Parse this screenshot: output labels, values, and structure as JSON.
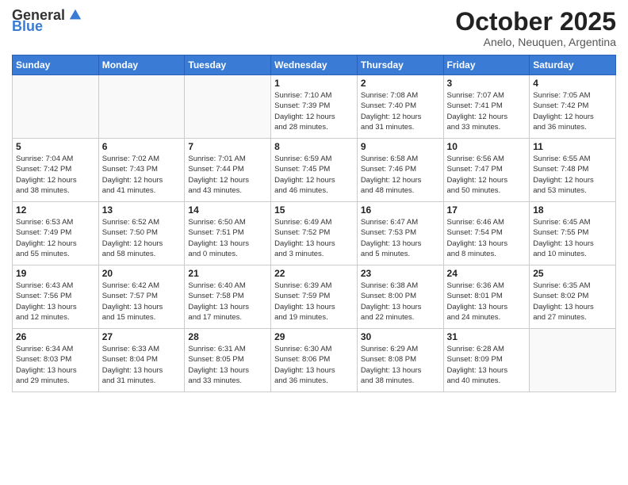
{
  "logo": {
    "general": "General",
    "blue": "Blue"
  },
  "calendar": {
    "title": "October 2025",
    "subtitle": "Anelo, Neuquen, Argentina",
    "days_of_week": [
      "Sunday",
      "Monday",
      "Tuesday",
      "Wednesday",
      "Thursday",
      "Friday",
      "Saturday"
    ],
    "weeks": [
      [
        {
          "day": "",
          "info": ""
        },
        {
          "day": "",
          "info": ""
        },
        {
          "day": "",
          "info": ""
        },
        {
          "day": "1",
          "info": "Sunrise: 7:10 AM\nSunset: 7:39 PM\nDaylight: 12 hours\nand 28 minutes."
        },
        {
          "day": "2",
          "info": "Sunrise: 7:08 AM\nSunset: 7:40 PM\nDaylight: 12 hours\nand 31 minutes."
        },
        {
          "day": "3",
          "info": "Sunrise: 7:07 AM\nSunset: 7:41 PM\nDaylight: 12 hours\nand 33 minutes."
        },
        {
          "day": "4",
          "info": "Sunrise: 7:05 AM\nSunset: 7:42 PM\nDaylight: 12 hours\nand 36 minutes."
        }
      ],
      [
        {
          "day": "5",
          "info": "Sunrise: 7:04 AM\nSunset: 7:42 PM\nDaylight: 12 hours\nand 38 minutes."
        },
        {
          "day": "6",
          "info": "Sunrise: 7:02 AM\nSunset: 7:43 PM\nDaylight: 12 hours\nand 41 minutes."
        },
        {
          "day": "7",
          "info": "Sunrise: 7:01 AM\nSunset: 7:44 PM\nDaylight: 12 hours\nand 43 minutes."
        },
        {
          "day": "8",
          "info": "Sunrise: 6:59 AM\nSunset: 7:45 PM\nDaylight: 12 hours\nand 46 minutes."
        },
        {
          "day": "9",
          "info": "Sunrise: 6:58 AM\nSunset: 7:46 PM\nDaylight: 12 hours\nand 48 minutes."
        },
        {
          "day": "10",
          "info": "Sunrise: 6:56 AM\nSunset: 7:47 PM\nDaylight: 12 hours\nand 50 minutes."
        },
        {
          "day": "11",
          "info": "Sunrise: 6:55 AM\nSunset: 7:48 PM\nDaylight: 12 hours\nand 53 minutes."
        }
      ],
      [
        {
          "day": "12",
          "info": "Sunrise: 6:53 AM\nSunset: 7:49 PM\nDaylight: 12 hours\nand 55 minutes."
        },
        {
          "day": "13",
          "info": "Sunrise: 6:52 AM\nSunset: 7:50 PM\nDaylight: 12 hours\nand 58 minutes."
        },
        {
          "day": "14",
          "info": "Sunrise: 6:50 AM\nSunset: 7:51 PM\nDaylight: 13 hours\nand 0 minutes."
        },
        {
          "day": "15",
          "info": "Sunrise: 6:49 AM\nSunset: 7:52 PM\nDaylight: 13 hours\nand 3 minutes."
        },
        {
          "day": "16",
          "info": "Sunrise: 6:47 AM\nSunset: 7:53 PM\nDaylight: 13 hours\nand 5 minutes."
        },
        {
          "day": "17",
          "info": "Sunrise: 6:46 AM\nSunset: 7:54 PM\nDaylight: 13 hours\nand 8 minutes."
        },
        {
          "day": "18",
          "info": "Sunrise: 6:45 AM\nSunset: 7:55 PM\nDaylight: 13 hours\nand 10 minutes."
        }
      ],
      [
        {
          "day": "19",
          "info": "Sunrise: 6:43 AM\nSunset: 7:56 PM\nDaylight: 13 hours\nand 12 minutes."
        },
        {
          "day": "20",
          "info": "Sunrise: 6:42 AM\nSunset: 7:57 PM\nDaylight: 13 hours\nand 15 minutes."
        },
        {
          "day": "21",
          "info": "Sunrise: 6:40 AM\nSunset: 7:58 PM\nDaylight: 13 hours\nand 17 minutes."
        },
        {
          "day": "22",
          "info": "Sunrise: 6:39 AM\nSunset: 7:59 PM\nDaylight: 13 hours\nand 19 minutes."
        },
        {
          "day": "23",
          "info": "Sunrise: 6:38 AM\nSunset: 8:00 PM\nDaylight: 13 hours\nand 22 minutes."
        },
        {
          "day": "24",
          "info": "Sunrise: 6:36 AM\nSunset: 8:01 PM\nDaylight: 13 hours\nand 24 minutes."
        },
        {
          "day": "25",
          "info": "Sunrise: 6:35 AM\nSunset: 8:02 PM\nDaylight: 13 hours\nand 27 minutes."
        }
      ],
      [
        {
          "day": "26",
          "info": "Sunrise: 6:34 AM\nSunset: 8:03 PM\nDaylight: 13 hours\nand 29 minutes."
        },
        {
          "day": "27",
          "info": "Sunrise: 6:33 AM\nSunset: 8:04 PM\nDaylight: 13 hours\nand 31 minutes."
        },
        {
          "day": "28",
          "info": "Sunrise: 6:31 AM\nSunset: 8:05 PM\nDaylight: 13 hours\nand 33 minutes."
        },
        {
          "day": "29",
          "info": "Sunrise: 6:30 AM\nSunset: 8:06 PM\nDaylight: 13 hours\nand 36 minutes."
        },
        {
          "day": "30",
          "info": "Sunrise: 6:29 AM\nSunset: 8:08 PM\nDaylight: 13 hours\nand 38 minutes."
        },
        {
          "day": "31",
          "info": "Sunrise: 6:28 AM\nSunset: 8:09 PM\nDaylight: 13 hours\nand 40 minutes."
        },
        {
          "day": "",
          "info": ""
        }
      ]
    ]
  }
}
